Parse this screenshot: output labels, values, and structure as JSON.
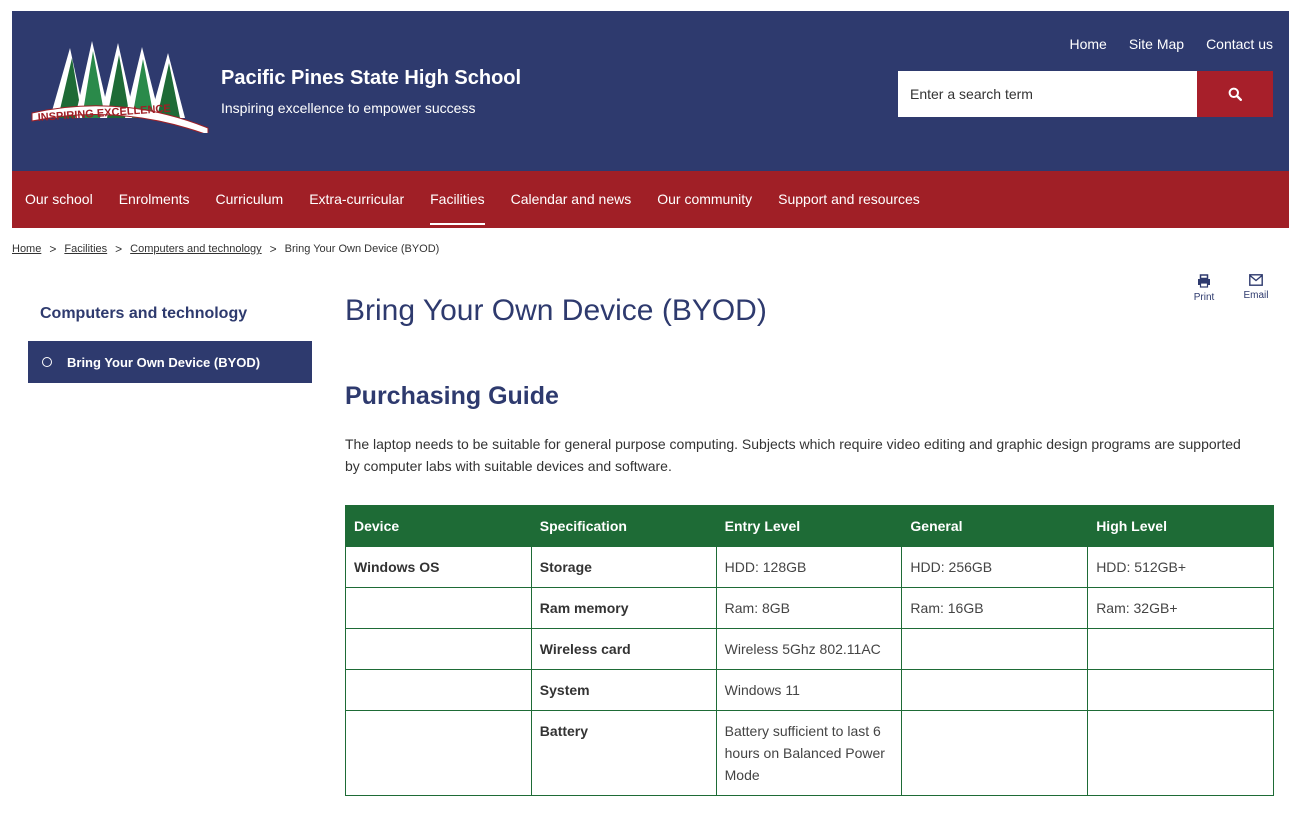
{
  "header": {
    "school_name": "Pacific Pines State High School",
    "tagline": "Inspiring excellence to empower success",
    "logo_text": "INSPIRING EXCELLENCE",
    "top_links": [
      "Home",
      "Site Map",
      "Contact us"
    ],
    "search_placeholder": "Enter a search term"
  },
  "nav": [
    "Our school",
    "Enrolments",
    "Curriculum",
    "Extra-curricular",
    "Facilities",
    "Calendar and news",
    "Our community",
    "Support and resources"
  ],
  "nav_active": "Facilities",
  "breadcrumb": [
    "Home",
    "Facilities",
    "Computers and technology",
    "Bring Your Own Device (BYOD)"
  ],
  "tools": {
    "print": "Print",
    "email": "Email"
  },
  "sidebar": {
    "title": "Computers and technology",
    "item": "Bring Your Own Device (BYOD)"
  },
  "main": {
    "title": "Bring Your Own Device (BYOD)",
    "subtitle": "Purchasing Guide",
    "intro": "The laptop needs to be suitable for general purpose computing. Subjects which require video editing and graphic design programs are supported by computer labs with suitable devices and software."
  },
  "table": {
    "headers": [
      "Device",
      "Specification",
      "Entry Level",
      "General",
      "High Level"
    ],
    "rows": [
      [
        "Windows OS",
        "Storage",
        "HDD: 128GB",
        "HDD: 256GB",
        "HDD: 512GB+"
      ],
      [
        "",
        "Ram memory",
        "Ram: 8GB",
        "Ram: 16GB",
        "Ram: 32GB+"
      ],
      [
        "",
        "Wireless card",
        "Wireless 5Ghz 802.11AC",
        "",
        ""
      ],
      [
        "",
        "System",
        "Windows 11",
        "",
        ""
      ],
      [
        "",
        "Battery",
        "Battery sufficient to last 6 hours on Balanced Power Mode",
        "",
        ""
      ]
    ]
  },
  "colors": {
    "navy": "#2e3a6e",
    "red": "#a01f26",
    "green": "#1e6b36"
  }
}
